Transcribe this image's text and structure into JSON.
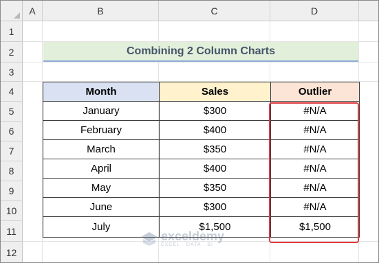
{
  "columns": [
    "A",
    "B",
    "C",
    "D"
  ],
  "rows": [
    "1",
    "2",
    "3",
    "4",
    "5",
    "6",
    "7",
    "8",
    "9",
    "10",
    "11",
    "12"
  ],
  "title": "Combining 2 Column Charts",
  "table": {
    "headers": [
      "Month",
      "Sales",
      "Outlier"
    ],
    "rows": [
      [
        "January",
        "$300",
        "#N/A"
      ],
      [
        "February",
        "$400",
        "#N/A"
      ],
      [
        "March",
        "$350",
        "#N/A"
      ],
      [
        "April",
        "$400",
        "#N/A"
      ],
      [
        "May",
        "$350",
        "#N/A"
      ],
      [
        "June",
        "$300",
        "#N/A"
      ],
      [
        "July",
        "$1,500",
        "$1,500"
      ]
    ]
  },
  "watermark": {
    "name": "exceldemy",
    "tagline": "EXCEL · DATA · BI"
  },
  "colors": {
    "title_fill": "#e2efda",
    "month_header": "#d9e1f2",
    "sales_header": "#fff2cc",
    "outlier_header": "#fce4d6",
    "highlight_border": "#e0393e"
  }
}
